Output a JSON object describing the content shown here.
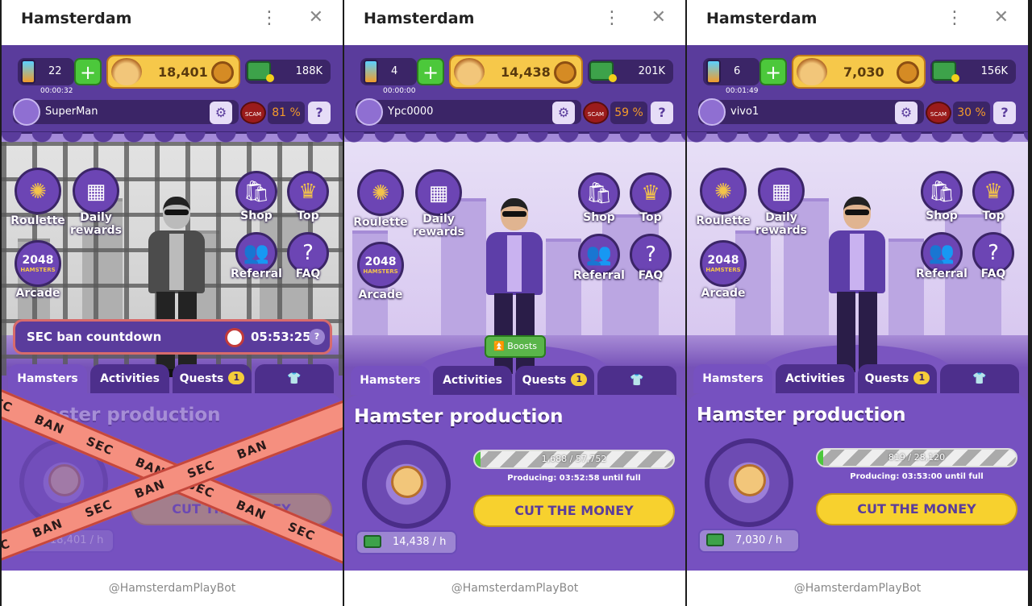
{
  "title": "Hamsterdam",
  "footer": "@HamsterdamPlayBot",
  "menu": {
    "roulette": "Roulette",
    "daily_line1": "Daily",
    "daily_line2": "rewards",
    "shop": "Shop",
    "top": "Top",
    "referral": "Referral",
    "faq": "FAQ",
    "arcade": "Arcade",
    "arcade_badge_num": "2048",
    "arcade_badge_word": "HAMSTERS"
  },
  "tabs": {
    "hamsters": "Hamsters",
    "activities": "Activities",
    "quests": "Quests",
    "quests_badge": "1"
  },
  "production": {
    "title": "Hamster production",
    "cut": "CUT THE MONEY"
  },
  "panels": [
    {
      "energy": "22",
      "timer": "00:00:32",
      "coins": "18,401",
      "cash": "188K",
      "username": "SuperMan",
      "scam_pct": "81 %",
      "sec_label": "SEC ban countdown",
      "sec_time": "05:53:25",
      "rate": "18,401 / h",
      "tape_word_sec": "SEC",
      "tape_word_ban": "BAN"
    },
    {
      "energy": "4",
      "timer": "00:00:00",
      "coins": "14,438",
      "cash": "201K",
      "username": "Ypc0000",
      "scam_pct": "59 %",
      "boosts": "Boosts",
      "progress_text": "1,688 / 57,752",
      "progress_fraction": 0.029,
      "producing": "Producing: 03:52:58 until full",
      "rate": "14,438 / h"
    },
    {
      "energy": "6",
      "timer": "00:01:49",
      "coins": "7,030",
      "cash": "156K",
      "username": "vivo1",
      "scam_pct": "30 %",
      "progress_text": "819 / 28,120",
      "progress_fraction": 0.029,
      "producing": "Producing: 03:53:00 until full",
      "rate": "7,030 / h"
    }
  ],
  "colors": {
    "accent": "#7651c0",
    "gold": "#f7d12e",
    "green": "#4cc83b",
    "scam": "#9b1b1b"
  },
  "icons": {
    "close": "close-icon",
    "more": "kebab-menu-icon",
    "settings": "gear-icon",
    "help": "help-icon",
    "shirt": "shirt-icon"
  }
}
